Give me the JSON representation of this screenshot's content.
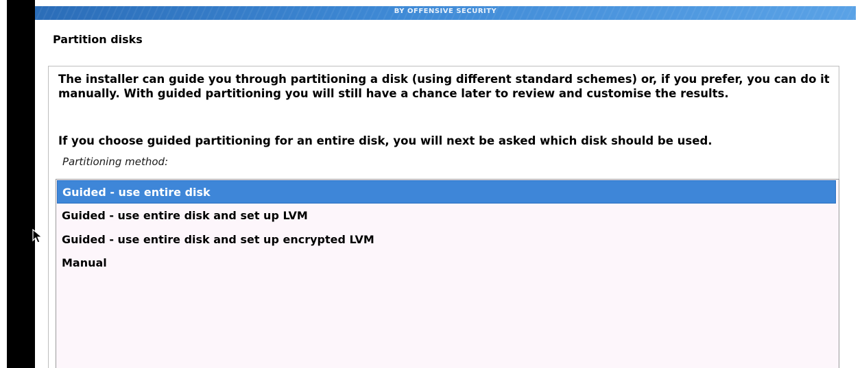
{
  "banner": {
    "text": "BY OFFENSIVE SECURITY"
  },
  "dialog": {
    "title": "Partition disks",
    "paragraph_1": "The installer can guide you through partitioning a disk (using different standard schemes) or, if you prefer, you can do it manually. With guided partitioning you will still have a chance later to review and customise the results.",
    "paragraph_2": "If you choose guided partitioning for an entire disk, you will next be asked which disk should be used.",
    "method_label": "Partitioning method:"
  },
  "methods": [
    {
      "label": "Guided - use entire disk",
      "selected": true
    },
    {
      "label": "Guided - use entire disk and set up LVM",
      "selected": false
    },
    {
      "label": "Guided - use entire disk and set up encrypted LVM",
      "selected": false
    },
    {
      "label": "Manual",
      "selected": false
    }
  ],
  "colors": {
    "selection": "#3e86d8",
    "banner": "#3f8ad6",
    "list_background": "#fdf6fb"
  },
  "icons": {
    "cursor": "mouse-pointer-icon"
  }
}
